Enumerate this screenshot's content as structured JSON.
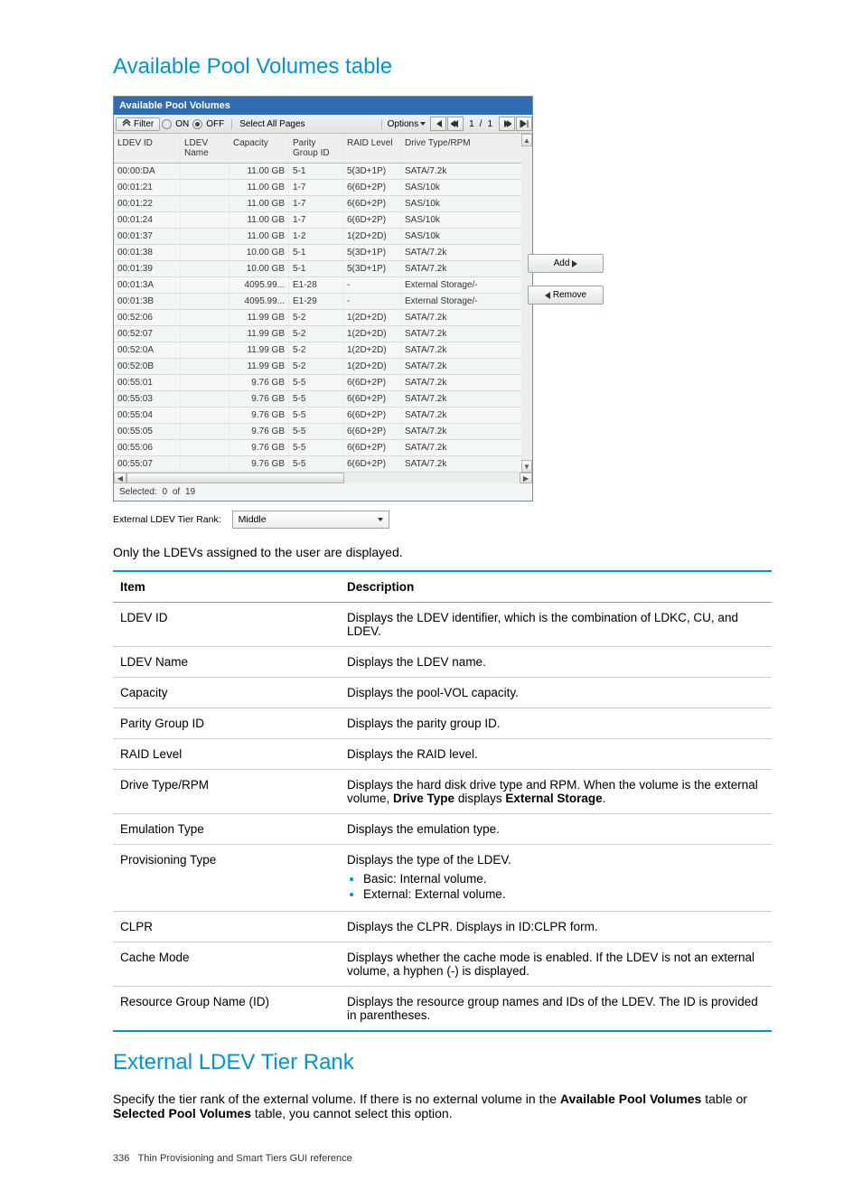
{
  "section1_title": "Available Pool Volumes table",
  "panel_title": "Available Pool Volumes",
  "toolbar": {
    "filter": "Filter",
    "on": "ON",
    "off": "OFF",
    "select_all": "Select All Pages",
    "options": "Options",
    "page_current": "1",
    "page_sep": "/",
    "page_total": "1"
  },
  "columns": {
    "ldev_id": "LDEV ID",
    "ldev_name": "LDEV Name",
    "capacity": "Capacity",
    "parity_group": "Parity Group ID",
    "raid": "RAID Level",
    "drive": "Drive Type/RPM"
  },
  "rows": [
    {
      "id": "00:00:DA",
      "name": "",
      "cap": "11.00 GB",
      "pg": "5-1",
      "raid": "5(3D+1P)",
      "drv": "SATA/7.2k"
    },
    {
      "id": "00:01:21",
      "name": "",
      "cap": "11.00 GB",
      "pg": "1-7",
      "raid": "6(6D+2P)",
      "drv": "SAS/10k"
    },
    {
      "id": "00:01:22",
      "name": "",
      "cap": "11.00 GB",
      "pg": "1-7",
      "raid": "6(6D+2P)",
      "drv": "SAS/10k"
    },
    {
      "id": "00:01:24",
      "name": "",
      "cap": "11.00 GB",
      "pg": "1-7",
      "raid": "6(6D+2P)",
      "drv": "SAS/10k"
    },
    {
      "id": "00:01:37",
      "name": "",
      "cap": "11.00 GB",
      "pg": "1-2",
      "raid": "1(2D+2D)",
      "drv": "SAS/10k"
    },
    {
      "id": "00:01:38",
      "name": "",
      "cap": "10.00 GB",
      "pg": "5-1",
      "raid": "5(3D+1P)",
      "drv": "SATA/7.2k"
    },
    {
      "id": "00:01:39",
      "name": "",
      "cap": "10.00 GB",
      "pg": "5-1",
      "raid": "5(3D+1P)",
      "drv": "SATA/7.2k"
    },
    {
      "id": "00:01:3A",
      "name": "",
      "cap": "4095.99...",
      "pg": "E1-28",
      "raid": "-",
      "drv": "External Storage/-"
    },
    {
      "id": "00:01:3B",
      "name": "",
      "cap": "4095.99...",
      "pg": "E1-29",
      "raid": "-",
      "drv": "External Storage/-"
    },
    {
      "id": "00:52:06",
      "name": "",
      "cap": "11.99 GB",
      "pg": "5-2",
      "raid": "1(2D+2D)",
      "drv": "SATA/7.2k"
    },
    {
      "id": "00:52:07",
      "name": "",
      "cap": "11.99 GB",
      "pg": "5-2",
      "raid": "1(2D+2D)",
      "drv": "SATA/7.2k"
    },
    {
      "id": "00:52:0A",
      "name": "",
      "cap": "11.99 GB",
      "pg": "5-2",
      "raid": "1(2D+2D)",
      "drv": "SATA/7.2k"
    },
    {
      "id": "00:52:0B",
      "name": "",
      "cap": "11.99 GB",
      "pg": "5-2",
      "raid": "1(2D+2D)",
      "drv": "SATA/7.2k"
    },
    {
      "id": "00:55:01",
      "name": "",
      "cap": "9.76 GB",
      "pg": "5-5",
      "raid": "6(6D+2P)",
      "drv": "SATA/7.2k"
    },
    {
      "id": "00:55:03",
      "name": "",
      "cap": "9.76 GB",
      "pg": "5-5",
      "raid": "6(6D+2P)",
      "drv": "SATA/7.2k"
    },
    {
      "id": "00:55:04",
      "name": "",
      "cap": "9.76 GB",
      "pg": "5-5",
      "raid": "6(6D+2P)",
      "drv": "SATA/7.2k"
    },
    {
      "id": "00:55:05",
      "name": "",
      "cap": "9.76 GB",
      "pg": "5-5",
      "raid": "6(6D+2P)",
      "drv": "SATA/7.2k"
    },
    {
      "id": "00:55:06",
      "name": "",
      "cap": "9.76 GB",
      "pg": "5-5",
      "raid": "6(6D+2P)",
      "drv": "SATA/7.2k"
    },
    {
      "id": "00:55:07",
      "name": "",
      "cap": "9.76 GB",
      "pg": "5-5",
      "raid": "6(6D+2P)",
      "drv": "SATA/7.2k"
    }
  ],
  "status": {
    "selected_label": "Selected:",
    "selected": "0",
    "of": "of",
    "total": "19"
  },
  "tier": {
    "label": "External LDEV Tier Rank:",
    "value": "Middle"
  },
  "side": {
    "add": "Add",
    "remove": "Remove"
  },
  "body1": "Only the LDEVs assigned to the user are displayed.",
  "desc_head": {
    "item": "Item",
    "desc": "Description"
  },
  "desc": [
    {
      "item": "LDEV ID",
      "text": "Displays the LDEV identifier, which is the combination of LDKC, CU, and LDEV."
    },
    {
      "item": "LDEV Name",
      "text": "Displays the LDEV name."
    },
    {
      "item": "Capacity",
      "text": "Displays the pool-VOL capacity."
    },
    {
      "item": "Parity Group ID",
      "text": "Displays the parity group ID."
    },
    {
      "item": "RAID Level",
      "text": "Displays the RAID level."
    },
    {
      "item": "Drive Type/RPM",
      "html": "Displays the hard disk drive type and RPM. When the volume is the external volume, <b>Drive Type</b> displays <b>External Storage</b>."
    },
    {
      "item": "Emulation Type",
      "text": "Displays the emulation type."
    },
    {
      "item": "Provisioning Type",
      "text": "Displays the type of the LDEV.",
      "list": [
        "Basic: Internal volume.",
        "External: External volume."
      ]
    },
    {
      "item": "CLPR",
      "text": "Displays the CLPR. Displays in ID:CLPR form."
    },
    {
      "item": "Cache Mode",
      "text": "Displays whether the cache mode is enabled. If the LDEV is not an external volume, a hyphen (-) is displayed."
    },
    {
      "item": "Resource Group Name (ID)",
      "text": "Displays the resource group names and IDs of the LDEV. The ID is provided in parentheses."
    }
  ],
  "section2_title": "External LDEV Tier Rank",
  "body2_html": "Specify the tier rank of the external volume. If there is no external volume in the <b>Available Pool Volumes</b> table or <b>Selected Pool Volumes</b> table, you cannot select this option.",
  "footer": {
    "page": "336",
    "text": "Thin Provisioning and Smart Tiers GUI reference"
  }
}
